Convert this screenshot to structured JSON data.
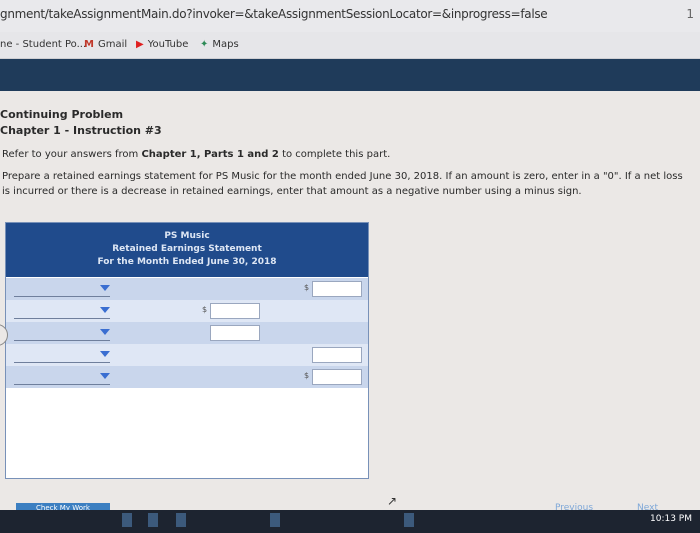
{
  "browser": {
    "url": "gnment/takeAssignmentMain.do?invoker=&takeAssignmentSessionLocator=&inprogress=false",
    "ext_badge": "1"
  },
  "bookmarks": [
    {
      "label": "ne - Student Po...",
      "icon": "page-icon"
    },
    {
      "label": "Gmail",
      "icon": "gmail-icon"
    },
    {
      "label": "YouTube",
      "icon": "youtube-icon"
    },
    {
      "label": "Maps",
      "icon": "maps-icon"
    }
  ],
  "problem": {
    "heading": "Continuing Problem",
    "subheading": "Chapter 1 - Instruction #3",
    "refer_prefix": "Refer to your answers from ",
    "refer_bold": "Chapter 1, Parts 1 and 2",
    "refer_suffix": " to complete this part.",
    "instructions": "Prepare a retained earnings statement for PS Music for the month ended June 30, 2018. If an amount is zero, enter in a \"0\". If a net loss is incurred or there is a decrease in retained earnings, enter that amount as a negative number using a minus sign."
  },
  "statement": {
    "company": "PS Music",
    "title": "Retained Earnings Statement",
    "period": "For the Month Ended June 30, 2018",
    "currency_symbol": "$",
    "rows": [
      {
        "dropdown": "",
        "amount_inner": null,
        "amount_outer": "",
        "outer_dollar": true
      },
      {
        "dropdown": "",
        "amount_inner": "",
        "inner_dollar": true,
        "amount_outer": null
      },
      {
        "dropdown": "",
        "amount_inner": "",
        "amount_outer": null
      },
      {
        "dropdown": "",
        "amount_inner": null,
        "amount_outer": ""
      },
      {
        "dropdown": "",
        "amount_inner": null,
        "amount_outer": "",
        "outer_dollar": true
      }
    ]
  },
  "footer": {
    "check_my_work": "Check My Work",
    "previous": "Previous",
    "next": "Next",
    "clock": "10:13 PM"
  },
  "colors": {
    "header_blue": "#204b8c",
    "nav_band": "#1f3b5a",
    "row_blue": "#c9d6ec"
  }
}
